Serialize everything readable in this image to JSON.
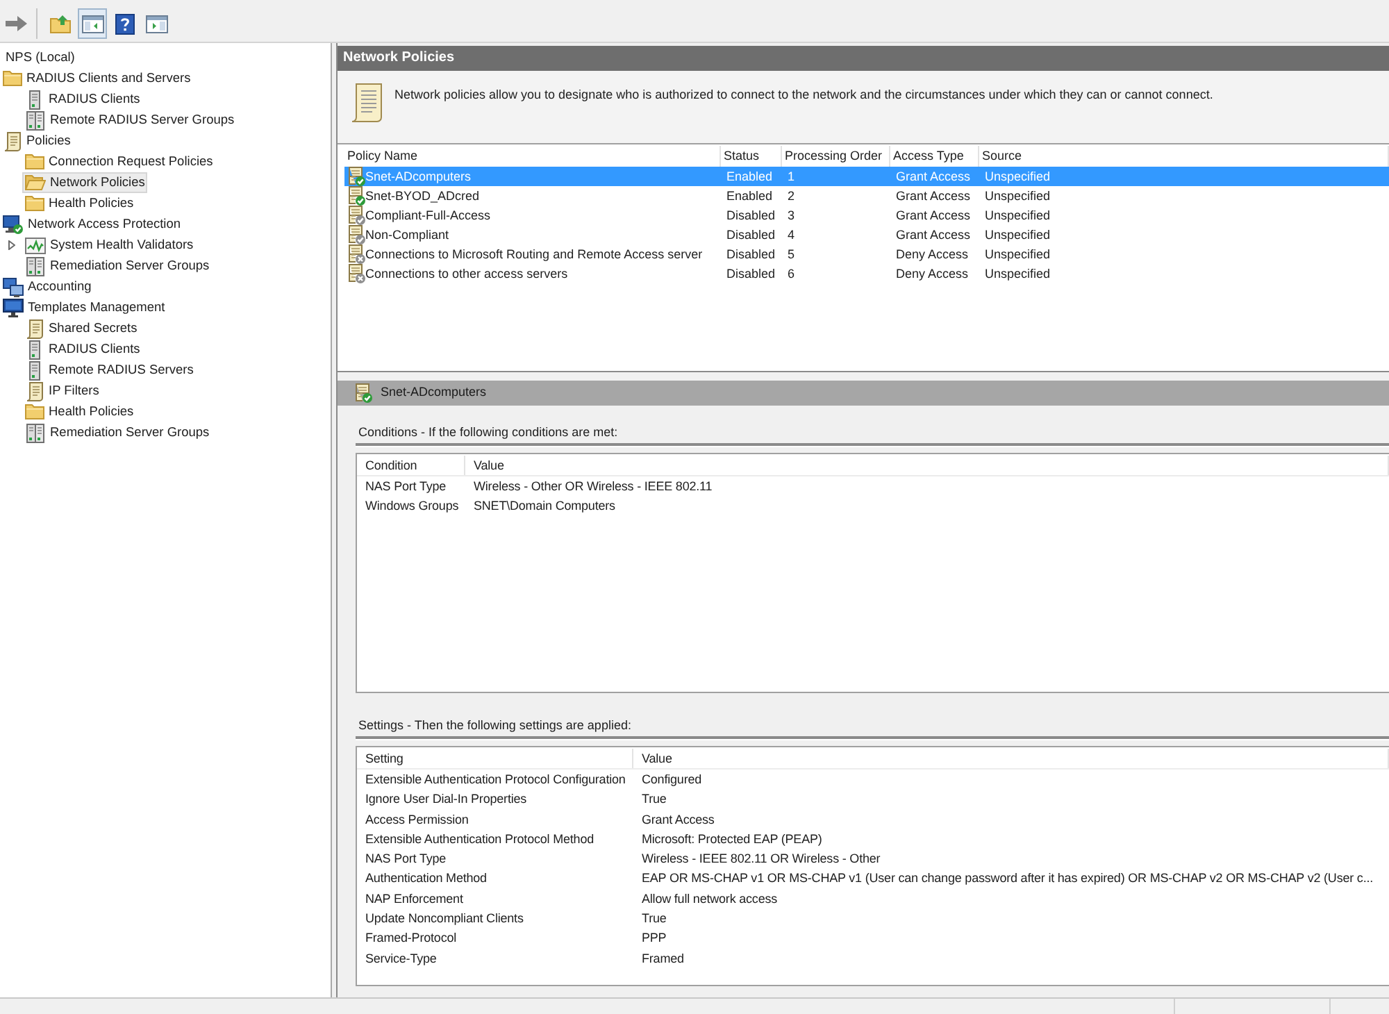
{
  "toolbar": [
    [
      {
        "kind": "forward",
        "pressed": false
      }
    ],
    [
      {
        "kind": "up",
        "pressed": false
      },
      {
        "kind": "tree",
        "pressed": true
      },
      {
        "kind": "help",
        "pressed": false
      },
      {
        "kind": "pane",
        "pressed": false
      }
    ]
  ],
  "tree": [
    {
      "label": "NPS (Local)",
      "selected": false,
      "collapsed": false,
      "children": [
        {
          "label": "RADIUS Clients and Servers",
          "kind": "folder",
          "selected": false,
          "collapsed": false,
          "children": [
            {
              "label": "RADIUS Clients",
              "kind": "server",
              "selected": false,
              "collapsed": false
            },
            {
              "label": "Remote RADIUS Server Groups",
              "kind": "server-group",
              "selected": false,
              "collapsed": false
            }
          ]
        },
        {
          "label": "Policies",
          "kind": "scroll",
          "selected": false,
          "collapsed": false,
          "children": [
            {
              "label": "Connection Request Policies",
              "kind": "folder",
              "selected": false,
              "collapsed": false
            },
            {
              "label": "Network Policies",
              "kind": "folder",
              "selected": true,
              "collapsed": false
            },
            {
              "label": "Health Policies",
              "kind": "folder",
              "selected": false,
              "collapsed": false
            }
          ]
        },
        {
          "label": "Network Access Protection",
          "kind": "nap",
          "selected": false,
          "collapsed": false,
          "children": [
            {
              "label": "System Health Validators",
              "kind": "chart",
              "selected": false,
              "collapsed": true
            },
            {
              "label": "Remediation Server Groups",
              "kind": "server-group",
              "selected": false,
              "collapsed": false
            }
          ]
        },
        {
          "label": "Accounting",
          "kind": "computers",
          "selected": false,
          "collapsed": false
        },
        {
          "label": "Templates Management",
          "kind": "monitor",
          "selected": false,
          "collapsed": false,
          "children": [
            {
              "label": "Shared Secrets",
              "kind": "scroll",
              "selected": false,
              "collapsed": false
            },
            {
              "label": "RADIUS Clients",
              "kind": "server",
              "selected": false,
              "collapsed": false
            },
            {
              "label": "Remote RADIUS Servers",
              "kind": "server",
              "selected": false,
              "collapsed": false
            },
            {
              "label": "IP Filters",
              "kind": "scroll",
              "selected": false,
              "collapsed": false
            },
            {
              "label": "Health Policies",
              "kind": "folder",
              "selected": false,
              "collapsed": false
            },
            {
              "label": "Remediation Server Groups",
              "kind": "server-group",
              "selected": false,
              "collapsed": false
            }
          ]
        }
      ]
    }
  ],
  "policies": {
    "title": "Network Policies",
    "description": "Network policies allow you to designate who is authorized to connect to the network and the circumstances under which they can or cannot connect.",
    "columns": [
      "Policy Name",
      "Status",
      "Processing Order",
      "Access Type",
      "Source"
    ],
    "rows": [
      {
        "cells": [
          "Snet-ADcomputers",
          "Enabled",
          "1",
          "Grant Access",
          "Unspecified"
        ],
        "kind": "grant",
        "enabled": true,
        "selected": true
      },
      {
        "cells": [
          "Snet-BYOD_ADcred",
          "Enabled",
          "2",
          "Grant Access",
          "Unspecified"
        ],
        "kind": "grant",
        "enabled": true,
        "selected": false
      },
      {
        "cells": [
          "Compliant-Full-Access",
          "Disabled",
          "3",
          "Grant Access",
          "Unspecified"
        ],
        "kind": "grant",
        "enabled": false,
        "selected": false
      },
      {
        "cells": [
          "Non-Compliant",
          "Disabled",
          "4",
          "Grant Access",
          "Unspecified"
        ],
        "kind": "grant",
        "enabled": false,
        "selected": false
      },
      {
        "cells": [
          "Connections to Microsoft Routing and Remote Access server",
          "Disabled",
          "5",
          "Deny Access",
          "Unspecified"
        ],
        "kind": "deny",
        "enabled": false,
        "selected": false
      },
      {
        "cells": [
          "Connections to other access servers",
          "Disabled",
          "6",
          "Deny Access",
          "Unspecified"
        ],
        "kind": "deny",
        "enabled": false,
        "selected": false
      }
    ]
  },
  "details": {
    "title": "Snet-ADcomputers",
    "kind": "grant",
    "enabled": true,
    "conditions": {
      "heading": "Conditions - If the following conditions are met:",
      "columns": [
        "Condition",
        "Value"
      ],
      "rows": [
        [
          "NAS Port Type",
          "Wireless - Other OR Wireless - IEEE 802.11"
        ],
        [
          "Windows Groups",
          "SNET\\Domain Computers"
        ]
      ]
    },
    "settings": {
      "heading": "Settings - Then the following settings are applied:",
      "columns": [
        "Setting",
        "Value"
      ],
      "rows": [
        [
          "Extensible Authentication Protocol Configuration",
          "Configured"
        ],
        [
          "Ignore User Dial-In Properties",
          "True"
        ],
        [
          "Access Permission",
          "Grant Access"
        ],
        [
          "Extensible Authentication Protocol Method",
          "Microsoft: Protected EAP (PEAP)"
        ],
        [
          "NAS Port Type",
          "Wireless - IEEE 802.11 OR Wireless - Other"
        ],
        [
          "Authentication Method",
          "EAP OR MS-CHAP v1 OR MS-CHAP v1 (User can change password after it has expired) OR MS-CHAP v2 OR MS-CHAP v2 (User c..."
        ],
        [
          "NAP Enforcement",
          "Allow full network access"
        ],
        [
          "Update Noncompliant Clients",
          "True"
        ],
        [
          "Framed-Protocol",
          "PPP"
        ],
        [
          "Service-Type",
          "Framed"
        ]
      ]
    }
  }
}
